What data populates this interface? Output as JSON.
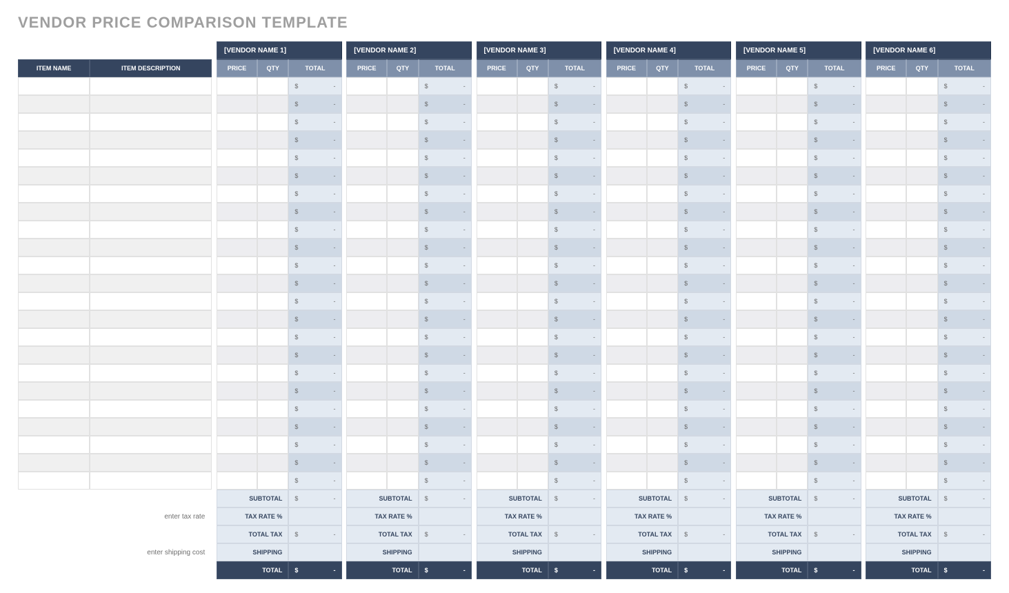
{
  "title": "VENDOR PRICE COMPARISON TEMPLATE",
  "headers": {
    "item_name": "ITEM NAME",
    "item_desc": "ITEM DESCRIPTION",
    "price": "PRICE",
    "qty": "QTY",
    "total": "TOTAL"
  },
  "vendors": [
    "[VENDOR NAME 1]",
    "[VENDOR NAME 2]",
    "[VENDOR NAME 3]",
    "[VENDOR NAME 4]",
    "[VENDOR NAME 5]",
    "[VENDOR NAME 6]"
  ],
  "data_row_count": 23,
  "currency": "$",
  "dash": "-",
  "footer": {
    "enter_tax_rate": "enter tax rate",
    "enter_shipping": "enter shipping cost",
    "subtotal": "SUBTOTAL",
    "tax_rate_pct": "TAX RATE %",
    "total_tax": "TOTAL TAX",
    "shipping": "SHIPPING",
    "total": "TOTAL"
  }
}
